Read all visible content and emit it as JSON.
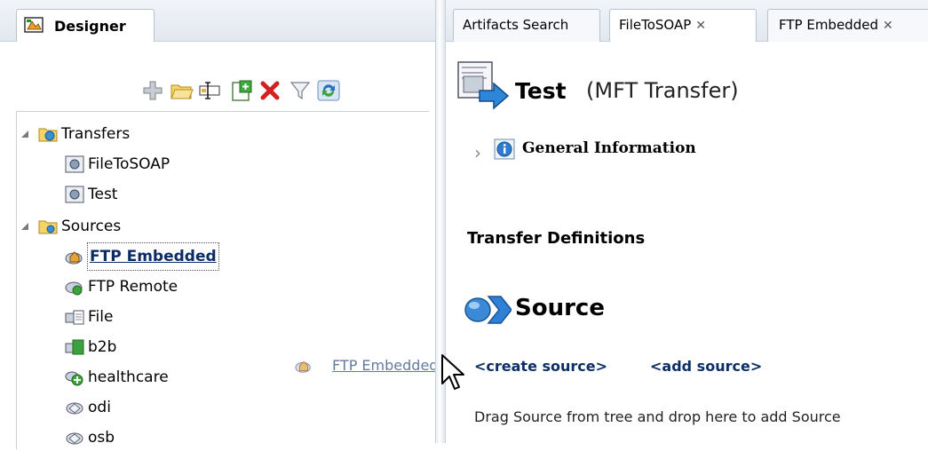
{
  "left_panel": {
    "tab_label": "Designer",
    "toolbar_icons": [
      "add-icon",
      "open-folder-icon",
      "rename-icon",
      "new-item-icon",
      "delete-icon",
      "filter-icon",
      "refresh-icon"
    ],
    "tree": {
      "transfers": {
        "label": "Transfers",
        "children": [
          "FileToSOAP",
          "Test"
        ]
      },
      "sources": {
        "label": "Sources",
        "children": [
          "FTP Embedded",
          "FTP Remote",
          "File",
          "b2b",
          "healthcare",
          "odi",
          "osb"
        ]
      }
    }
  },
  "drag_ghost": {
    "label": "FTP Embedded"
  },
  "right_panel": {
    "tabs": [
      {
        "label": "Artifacts Search",
        "closable": false
      },
      {
        "label": "FileToSOAP",
        "closable": true
      },
      {
        "label": "FTP Embedded",
        "closable": true
      }
    ],
    "editor": {
      "title": "Test",
      "type": "(MFT Transfer)",
      "general_info": "General Information",
      "transfer_definitions": "Transfer Definitions",
      "source_heading": "Source",
      "create_source": "<create source>",
      "add_source": "<add source>",
      "drag_hint": "Drag Source from tree and drop here to add Source"
    }
  },
  "colors": {
    "accent": "#0b2f66",
    "tab_bar": "#e2e8f0",
    "delete_red": "#d42020"
  }
}
